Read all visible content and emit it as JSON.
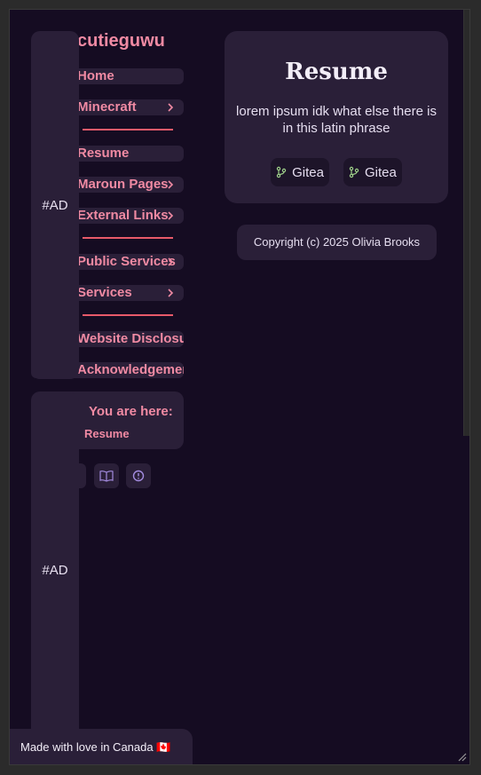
{
  "site": {
    "title": "cutieguwu"
  },
  "nav": {
    "items": [
      {
        "label": "Home",
        "has_chevron": false
      },
      {
        "label": "Minecraft",
        "has_chevron": true
      },
      {
        "label": "Resume",
        "has_chevron": false
      },
      {
        "label": "Maroun Pages",
        "has_chevron": true
      },
      {
        "label": "External Links",
        "has_chevron": true
      },
      {
        "label": "Public Services",
        "has_chevron": true
      },
      {
        "label": "Services",
        "has_chevron": true
      },
      {
        "label": "Website Disclosure",
        "has_chevron": false
      },
      {
        "label": "Acknowledgements",
        "has_chevron": false
      }
    ]
  },
  "ads": {
    "top_label": "#AD",
    "bottom_label": "#AD"
  },
  "breadcrumb": {
    "title": "You are here:",
    "current": "Resume"
  },
  "footer_icons": [
    "theme-icon",
    "book-icon",
    "alert-icon"
  ],
  "main": {
    "title": "Resume",
    "description": "lorem ipsum idk what else there is in this latin phrase",
    "links": [
      {
        "label": "Gitea",
        "icon": "git-branch-icon"
      },
      {
        "label": "Gitea",
        "icon": "git-branch-icon"
      }
    ]
  },
  "copyright": "Copyright (c) 2025 Olivia Brooks",
  "made_with": "Made with love in Canada 🇨🇦",
  "colors": {
    "background": "#150c22",
    "card": "#2a1f38",
    "accent": "#f08aa3",
    "divider": "#e85a6a",
    "icon": "#a48ce0"
  }
}
